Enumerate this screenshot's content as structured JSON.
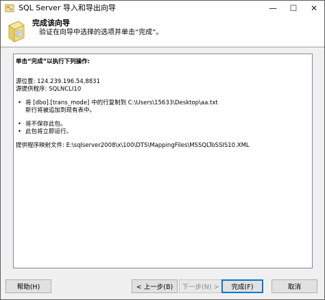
{
  "window": {
    "title": "SQL Server 导入和导出向导",
    "minimize_glyph": "—",
    "maximize_glyph": "☐",
    "close_glyph": "✕"
  },
  "header": {
    "title": "完成该向导",
    "subtitle": "验证在向导中选择的选项并单击“完成”。"
  },
  "content": {
    "heading": "单击“完成”以执行下列操作:",
    "source_location": "源位置: 124.239.196.54,8831",
    "source_provider": "源提供程序: SQLNCLI10",
    "bullet1_line1": "将 [dbo].[trans_mode] 中的行复制到 C:\\Users\\15633\\Desktop\\aa.txt",
    "bullet1_line2": "新行将被追加到现有表中。",
    "bullet2": "将不保存此包。",
    "bullet3": "此包将立即运行。",
    "mapping_file": "提供程序映射文件: E:\\sqlserver2008\\x\\100\\DTS\\MappingFiles\\MSSQLToSSIS10.XML",
    "bullet_glyph": "•"
  },
  "buttons": {
    "help": "帮助(H)",
    "back": "< 上一步(B)",
    "next": "下一步(N) >",
    "finish": "完成(F)",
    "cancel": "取消"
  },
  "colors": {
    "focus_border": "#0078d7",
    "disabled_text": "#8a8a8a",
    "icon_yellow": "#e8d24a"
  }
}
